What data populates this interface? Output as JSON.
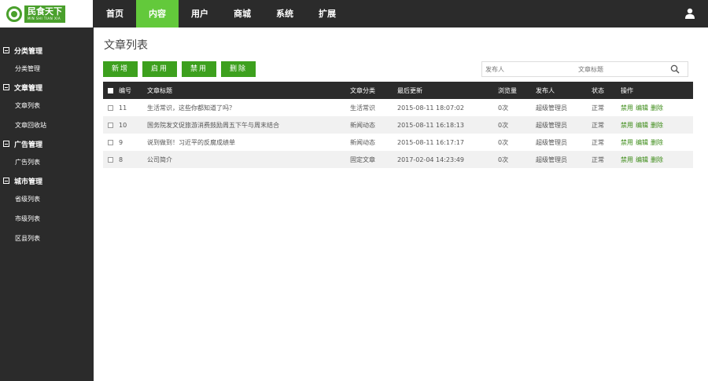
{
  "logo": {
    "text": "民食天下",
    "sub": "MIN SHI TIAN XIA"
  },
  "nav": {
    "items": [
      "首页",
      "内容",
      "用户",
      "商城",
      "系统",
      "扩展"
    ],
    "active_index": 1
  },
  "sidebar": {
    "groups": [
      {
        "title": "分类管理",
        "items": [
          "分类管理"
        ]
      },
      {
        "title": "文章管理",
        "items": [
          "文章列表",
          "文章回收站"
        ]
      },
      {
        "title": "广告管理",
        "items": [
          "广告列表"
        ]
      },
      {
        "title": "城市管理",
        "items": [
          "省级列表",
          "市级列表",
          "区县列表"
        ]
      }
    ]
  },
  "page": {
    "title": "文章列表"
  },
  "toolbar": {
    "add": "新增",
    "enable": "启用",
    "disable": "禁用",
    "delete": "删除"
  },
  "search": {
    "publisher_placeholder": "发布人",
    "title_placeholder": "文章标题"
  },
  "table": {
    "headers": [
      "编号",
      "文章标题",
      "文章分类",
      "最后更新",
      "浏览量",
      "发布人",
      "状态",
      "操作"
    ],
    "rows": [
      {
        "id": "11",
        "title": "生活常识，这些你都知道了吗？",
        "category": "生活常识",
        "updated": "2015-08-11 18:07:02",
        "views": "0次",
        "publisher": "超级管理员",
        "status": "正常",
        "actions": [
          "禁用",
          "编辑",
          "删除"
        ]
      },
      {
        "id": "10",
        "title": "国务院发文促旅游消费鼓励周五下午与周末结合",
        "category": "新闻动态",
        "updated": "2015-08-11 16:18:13",
        "views": "0次",
        "publisher": "超级管理员",
        "status": "正常",
        "actions": [
          "禁用",
          "编辑",
          "删除"
        ]
      },
      {
        "id": "9",
        "title": "说到做到！习近平的反腐成绩单",
        "category": "新闻动态",
        "updated": "2015-08-11 16:17:17",
        "views": "0次",
        "publisher": "超级管理员",
        "status": "正常",
        "actions": [
          "禁用",
          "编辑",
          "删除"
        ]
      },
      {
        "id": "8",
        "title": "公司简介",
        "category": "固定文章",
        "updated": "2017-02-04 14:23:49",
        "views": "0次",
        "publisher": "超级管理员",
        "status": "正常",
        "actions": [
          "禁用",
          "编辑",
          "删除"
        ]
      }
    ]
  },
  "colors": {
    "accent": "#63c93b",
    "button": "#3da01e",
    "dark": "#2b2b2b",
    "action": "#3a8a15"
  },
  "icons": {
    "user": "user-icon",
    "search": "search-icon",
    "collapse": "minus-box-icon"
  }
}
